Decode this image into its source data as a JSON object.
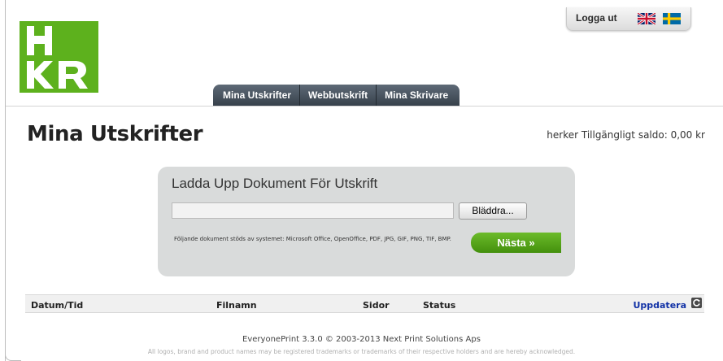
{
  "logo": {
    "text": "HKR",
    "color": "#5db11d"
  },
  "utility": {
    "logout_label": "Logga ut",
    "languages": [
      {
        "name": "english-flag-icon"
      },
      {
        "name": "swedish-flag-icon"
      }
    ]
  },
  "nav": {
    "tabs": [
      {
        "label": "Mina Utskrifter"
      },
      {
        "label": "Webbutskrift"
      },
      {
        "label": "Mina Skrivare"
      }
    ]
  },
  "page": {
    "title": "Mina Utskrifter",
    "balance": "herker Tillgängligt saldo: 0,00 kr"
  },
  "upload": {
    "title": "Ladda Upp Dokument För Utskrift",
    "file_value": "",
    "browse_label": "Bläddra...",
    "supported_formats": "Följande dokument stöds av systemet: Microsoft Office, OpenOffice, PDF, JPG, GIF, PNG, TIF, BMP.",
    "next_label": "Nästa »"
  },
  "table": {
    "columns": [
      "Datum/Tid",
      "Filnamn",
      "Sidor",
      "Status"
    ],
    "refresh_label": "Uppdatera",
    "rows": []
  },
  "footer": {
    "version": "EveryonePrint 3.3.0 © 2003-2013 Next Print Solutions Aps",
    "trademark": "All logos, brand and product names may be registered trademarks or trademarks of their respective holders and are hereby acknowledged."
  },
  "colors": {
    "accent_green": "#5db11d",
    "tab_dark": "#3e4852",
    "link_blue": "#1232a6"
  }
}
